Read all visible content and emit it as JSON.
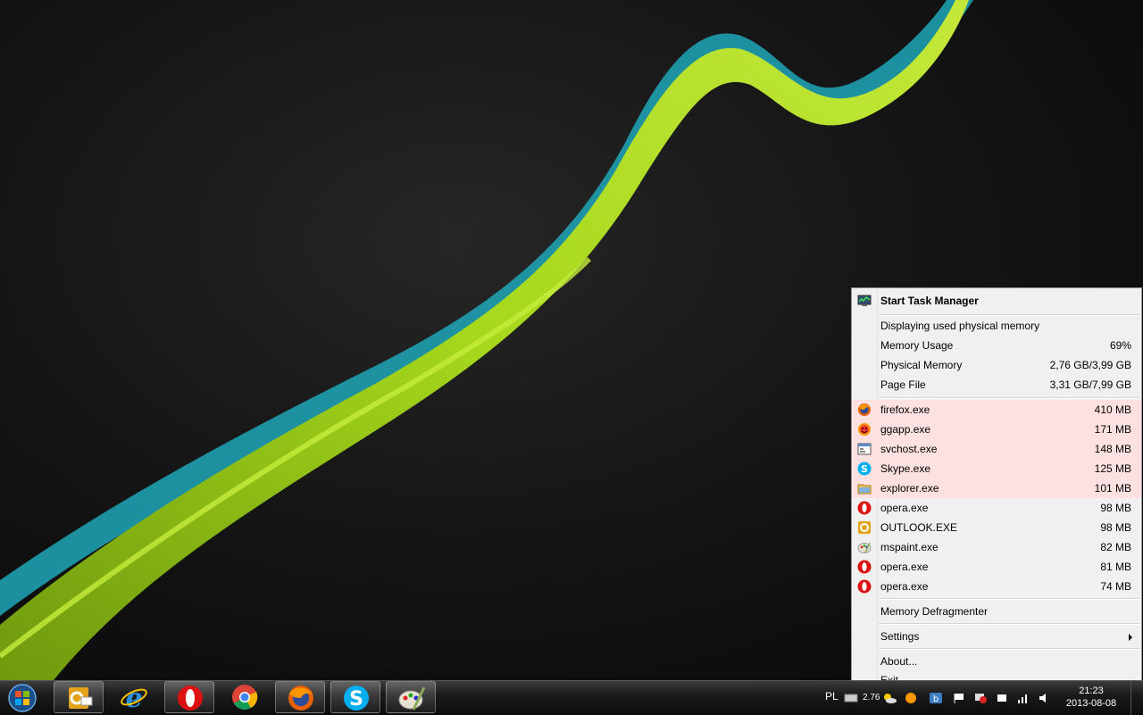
{
  "menu": {
    "header": "Start Task Manager",
    "info": {
      "title": "Displaying used physical memory",
      "rows": [
        {
          "label": "Memory Usage",
          "value": "69%"
        },
        {
          "label": "Physical Memory",
          "value": "2,76 GB/3,99 GB"
        },
        {
          "label": "Page File",
          "value": "3,31 GB/7,99 GB"
        }
      ]
    },
    "processes": [
      {
        "name": "firefox.exe",
        "value": "410 MB",
        "icon": "firefox-icon",
        "highlight": true
      },
      {
        "name": "ggapp.exe",
        "value": "171 MB",
        "icon": "gg-sun-icon",
        "highlight": true
      },
      {
        "name": "svchost.exe",
        "value": "148 MB",
        "icon": "window-icon",
        "highlight": true
      },
      {
        "name": "Skype.exe",
        "value": "125 MB",
        "icon": "skype-icon",
        "highlight": true
      },
      {
        "name": "explorer.exe",
        "value": "101 MB",
        "icon": "folder-icon",
        "highlight": true
      },
      {
        "name": "opera.exe",
        "value": "98 MB",
        "icon": "opera-icon",
        "highlight": false
      },
      {
        "name": "OUTLOOK.EXE",
        "value": "98 MB",
        "icon": "outlook-icon",
        "highlight": false
      },
      {
        "name": "mspaint.exe",
        "value": "82 MB",
        "icon": "paint-icon",
        "highlight": false
      },
      {
        "name": "opera.exe",
        "value": "81 MB",
        "icon": "opera-icon",
        "highlight": false
      },
      {
        "name": "opera.exe",
        "value": "74 MB",
        "icon": "opera-icon",
        "highlight": false
      }
    ],
    "defrag": "Memory Defragmenter",
    "settings": "Settings",
    "about": "About...",
    "exit": "Exit"
  },
  "taskbar": {
    "apps": [
      "outlook-icon",
      "internet-explorer-icon",
      "opera-icon",
      "chrome-icon",
      "firefox-icon",
      "skype-icon",
      "paint-icon"
    ],
    "language": "PL",
    "tray_value": "2.76",
    "date": "2013-08-08",
    "time": "21:23"
  },
  "colors": {
    "highlight": "#fde0e0",
    "wallpaper_green": "#9ed416",
    "wallpaper_teal": "#1fa7b8"
  }
}
